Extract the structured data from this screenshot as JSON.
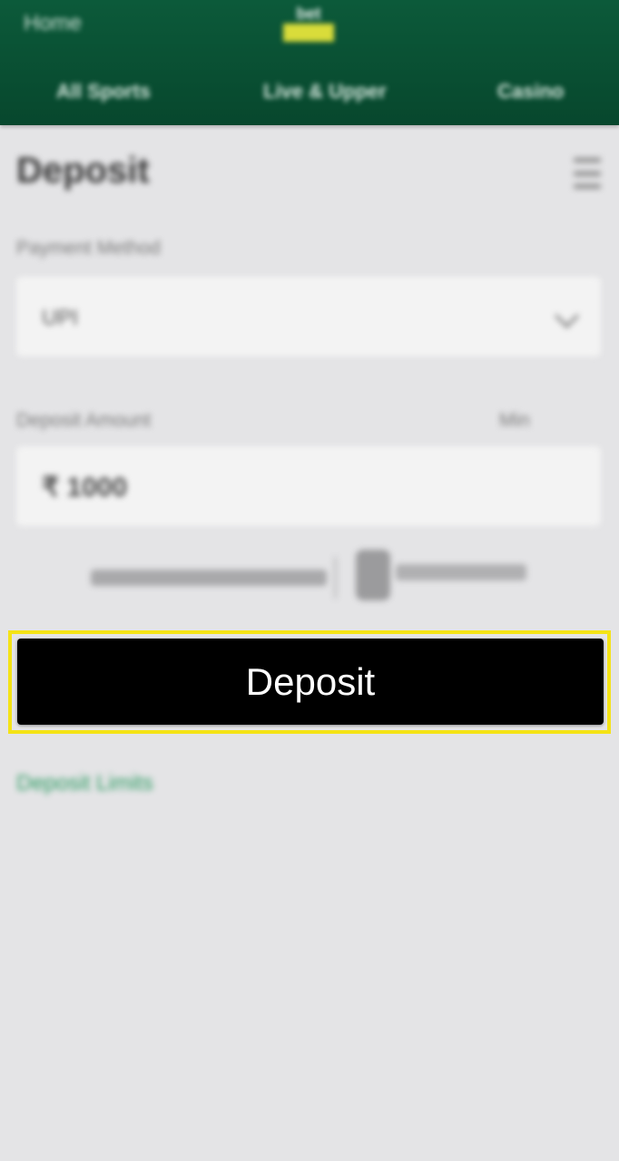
{
  "header": {
    "home_label": "Home",
    "logo_text": "bet",
    "nav_tabs": [
      "All Sports",
      "Live & Upper",
      "Casino"
    ]
  },
  "page": {
    "title": "Deposit"
  },
  "payment_method": {
    "label": "Payment Method",
    "selected": "UPI"
  },
  "deposit_amount": {
    "label": "Deposit Amount",
    "hint": "Min",
    "value": "₹ 1000"
  },
  "deposit_button": {
    "label": "Deposit"
  },
  "links": {
    "deposit_limits": "Deposit Limits"
  },
  "colors": {
    "header_green": "#0c5a3a",
    "highlight_yellow": "#f4e316",
    "button_black": "#000000",
    "link_green": "#2a9a60"
  },
  "icons": {
    "menu": "hamburger-menu-icon",
    "select_arrow": "chevron-down-icon"
  }
}
